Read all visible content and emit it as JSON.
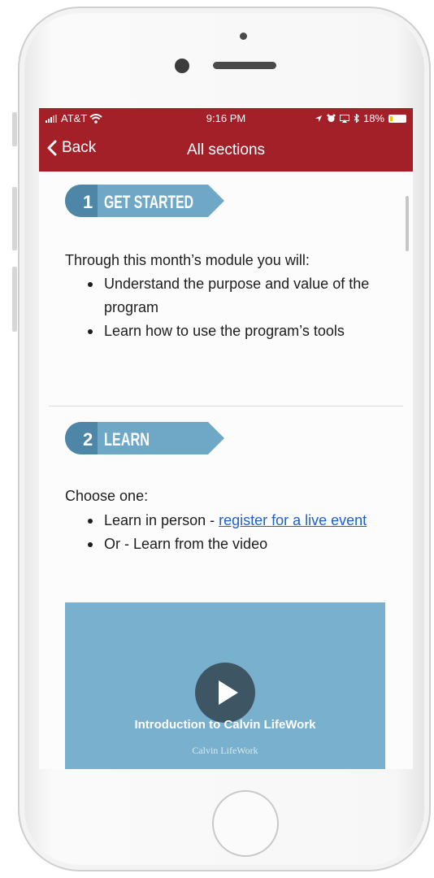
{
  "status_bar": {
    "carrier": "AT&T",
    "time": "9:16 PM",
    "battery": "18%",
    "battery_level": 0.18
  },
  "nav": {
    "back_label": "Back",
    "title": "All sections"
  },
  "sections": [
    {
      "number": "1",
      "banner": "GET STARTED",
      "intro": "Through this month’s module you will:",
      "bullets": [
        "Understand the purpose and value of the program",
        "Learn how to use the program’s tools"
      ]
    },
    {
      "number": "2",
      "banner": "LEARN",
      "intro": "Choose one:",
      "bullet1_prefix": "Learn in person - ",
      "bullet1_link": "register for a live event",
      "bullet2": "Or - Learn from the video"
    }
  ],
  "video": {
    "title": "Introduction to Calvin LifeWork",
    "logo_text": "Calvin LifeWork"
  },
  "colors": {
    "header": "#a32029",
    "banner": "#6fa8c6",
    "banner_number_bg": "#4d86a6",
    "video_bg": "#78b0cd",
    "link": "#2060c8"
  }
}
